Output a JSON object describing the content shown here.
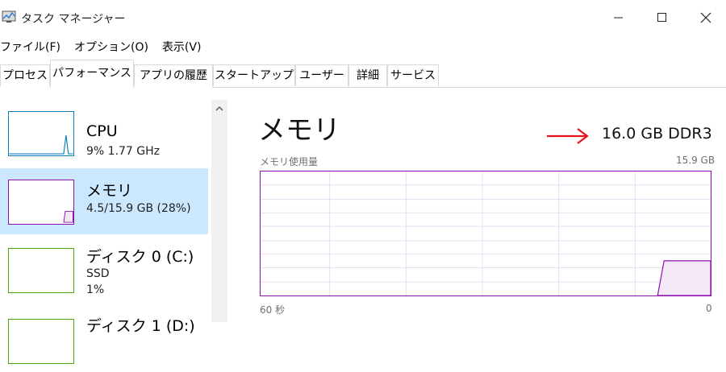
{
  "window": {
    "title": "タスク マネージャー",
    "minimize_glyph": "—",
    "maximize_glyph": "☐",
    "close_glyph": "✕"
  },
  "menu": [
    "ファイル(F)",
    "オプション(O)",
    "表示(V)"
  ],
  "tabs": [
    "プロセス",
    "パフォーマンス",
    "アプリの履歴",
    "スタートアップ",
    "ユーザー",
    "詳細",
    "サービス"
  ],
  "active_tab": "パフォーマンス",
  "sidebar": {
    "items": [
      {
        "title": "CPU",
        "subtitle": "9%  1.77 GHz",
        "color": "#117dbb"
      },
      {
        "title": "メモリ",
        "subtitle": "4.5/15.9 GB (28%)",
        "color": "#8b12ae",
        "selected": true
      },
      {
        "title": "ディスク 0 (C:)",
        "subtitle": "SSD",
        "subtitle2": "1%",
        "color": "#4da60c"
      },
      {
        "title": "ディスク 1 (D:)",
        "color": "#4da60c"
      }
    ]
  },
  "main": {
    "title": "メモリ",
    "spec": "16.0 GB DDR3",
    "graph_label": "メモリ使用量",
    "graph_max": "15.9 GB",
    "axis_left": "60 秒",
    "axis_right": "0",
    "usage_fraction": 0.28,
    "accent_color": "#8b12ae",
    "arrow_color": "#e8141b"
  },
  "icons": {
    "app": "task-manager-icon",
    "scroll_up": "chevron-up-icon",
    "annotation": "red-arrow-icon"
  }
}
